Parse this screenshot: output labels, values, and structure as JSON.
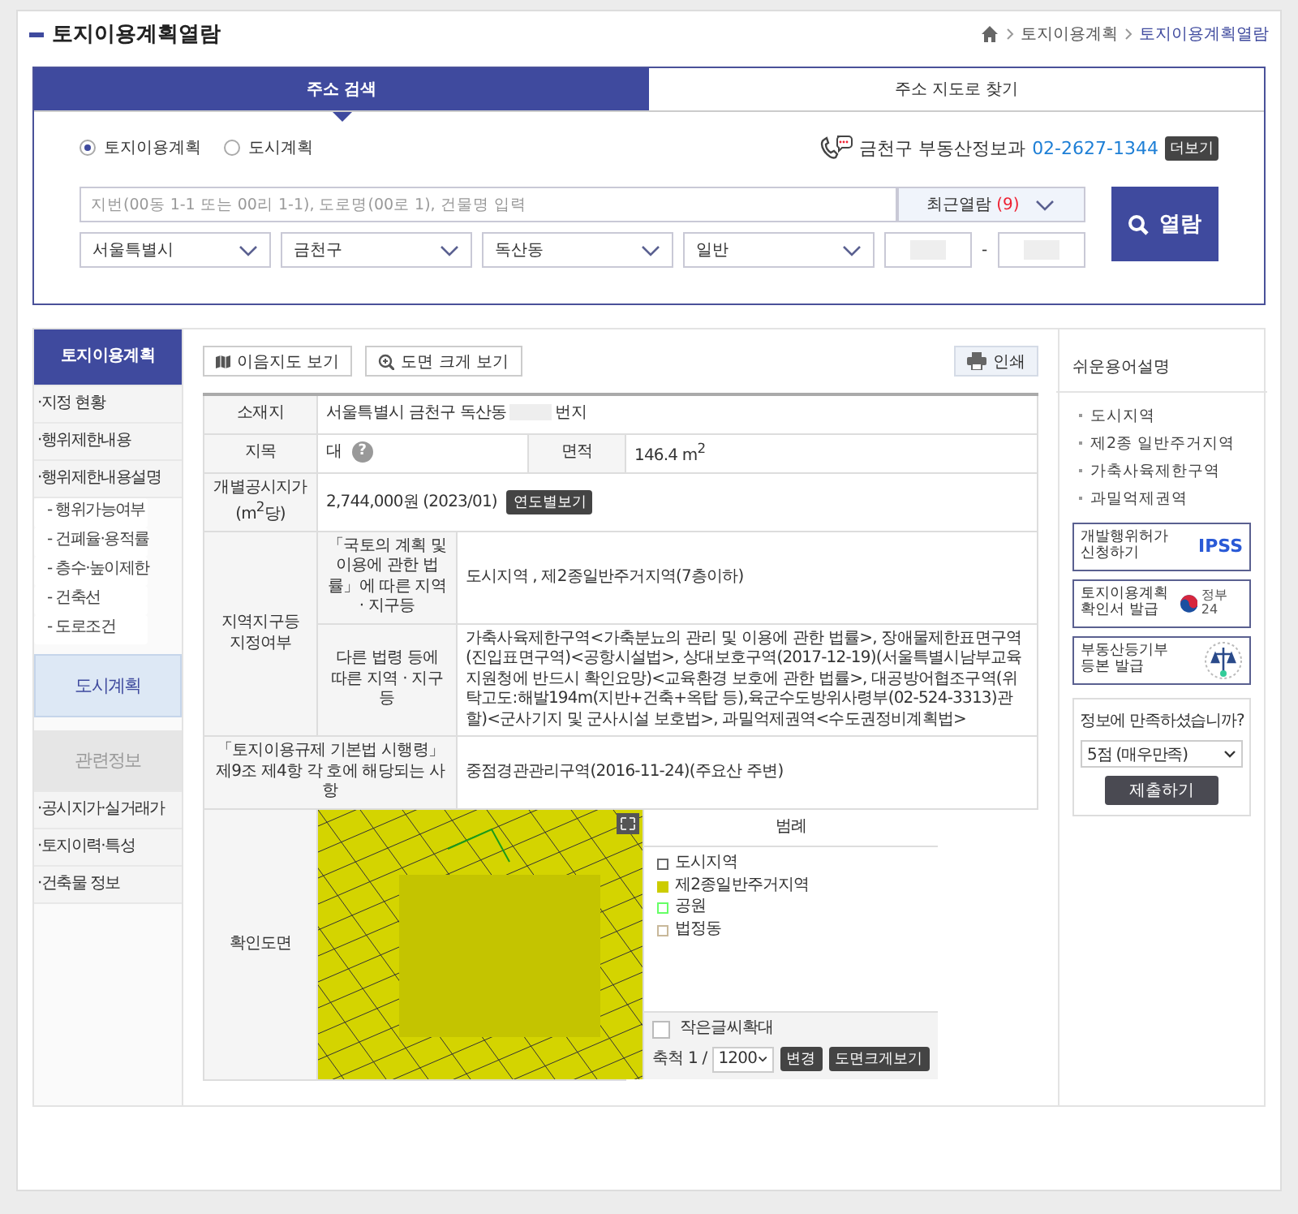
{
  "header": {
    "title": "토지이용계획열람",
    "breadcrumb": [
      {
        "label": "토지이용계획",
        "selected": false
      },
      {
        "label": "토지이용계획열람",
        "selected": true
      }
    ]
  },
  "search": {
    "tabs": [
      {
        "label": "주소 검색",
        "selected": true
      },
      {
        "label": "주소 지도로 찾기",
        "selected": false
      }
    ],
    "radios": [
      {
        "label": "토지이용계획",
        "selected": true
      },
      {
        "label": "도시계획",
        "selected": false
      }
    ],
    "contact": {
      "label": "금천구 부동산정보과",
      "phone": "02-2627-1344",
      "more": "더보기"
    },
    "input": {
      "placeholder": "지번(00동 1-1 또는 00리 1-1), 도로명(00로 1), 건물명 입력"
    },
    "recent": {
      "label": "최근열람",
      "count": "(9)"
    },
    "selects": [
      "서울특별시",
      "금천구",
      "독산동",
      "일반"
    ],
    "separator": "-",
    "button": "열람"
  },
  "sidebar": {
    "items": [
      {
        "kind": "header",
        "label": "토지이용계획"
      },
      {
        "kind": "link",
        "label": "·지정 현황"
      },
      {
        "kind": "link",
        "label": "·행위제한내용"
      },
      {
        "kind": "link",
        "label": "·행위제한내용설명"
      },
      {
        "kind": "sub",
        "label": "- 행위가능여부"
      },
      {
        "kind": "sub",
        "label": "- 건폐율·용적률"
      },
      {
        "kind": "sub",
        "label": "- 층수·높이제한"
      },
      {
        "kind": "sub",
        "label": "- 건축선"
      },
      {
        "kind": "sub",
        "label": "- 도로조건"
      },
      {
        "kind": "tile",
        "label": "도시계획"
      },
      {
        "kind": "tile-muted",
        "label": "관련정보"
      },
      {
        "kind": "link",
        "label": "·공시지가·실거래가"
      },
      {
        "kind": "link",
        "label": "·토지이력·특성"
      },
      {
        "kind": "link",
        "label": "·건축물 정보"
      }
    ]
  },
  "toolbar": {
    "buttons": [
      "이음지도 보기",
      "도면 크게 보기"
    ],
    "print": "인쇄"
  },
  "table": {
    "address": {
      "label": "소재지",
      "prefix": "서울특별시 금천구 독산동",
      "suffix": "번지"
    },
    "jimok": {
      "label": "지목",
      "value": "대",
      "help": "?",
      "area_label": "면적",
      "area": "146.4 m$^{2}$"
    },
    "price": {
      "label": "개별공시지가(m$^{2}$당)",
      "value": "2,744,000원 (2023/01)",
      "button": "연도별보기"
    },
    "zones": {
      "label": "지역지구등 지정여부",
      "rows": [
        {
          "label": "「국토의 계획 및 이용에 관한 법률」에 따른 지역 · 지구등",
          "value": "도시지역 , 제2종일반주거지역(7층이하)"
        },
        {
          "label": "다른 법령 등에 따른 지역 · 지구등",
          "value": "가축사육제한구역<가축분뇨의 관리 및 이용에 관한 법률>, 장애물제한표면구역(진입표면구역)<공항시설법>, 상대보호구역(2017-12-19)(서울특별시남부교육지원청에 반드시 확인요망)<교육환경 보호에 관한 법률>, 대공방어협조구역(위탁고도:해발194m(지반+건축+옥탑 등),육군수도방위사령부(02-524-3313)관할)<군사기지 및 군사시설 보호법>, 과밀억제권역<수도권정비계획법>"
        }
      ]
    },
    "decree": {
      "label": "「토지이용규제 기본법 시행령」 제9조 제4항 각 호에 해당되는 사항",
      "value": "중점경관관리구역(2016-11-24)(주요산 주변)"
    },
    "map": {
      "label": "확인도면",
      "legend_title": "범례",
      "legend": [
        {
          "label": "도시지역",
          "kind": "outline",
          "color": "#666666"
        },
        {
          "label": "제2종일반주거지역",
          "kind": "fill",
          "color": "#cccc00"
        },
        {
          "label": "공원",
          "kind": "outline",
          "color": "#66ff66"
        },
        {
          "label": "법정동",
          "kind": "outline",
          "color": "#c8b89a"
        }
      ],
      "enlarge": {
        "label": "작은글씨확대",
        "checked": false
      },
      "scale_label": "축척 1 /",
      "scale": "1200",
      "change": "변경",
      "big": "도면크게보기"
    }
  },
  "aside": {
    "title": "쉬운용어설명",
    "terms": [
      "도시지역",
      "제2종 일반주거지역",
      "가축사육제한구역",
      "과밀억제권역"
    ],
    "links": [
      {
        "label": "개발행위허가 신청하기",
        "kind": "ipss",
        "logo": "IPSS"
      },
      {
        "label": "토지이용계획 확인서 발급",
        "kind": "gov24",
        "logo": "정부24"
      },
      {
        "label": "부동산등기부등본 발급",
        "kind": "court"
      }
    ],
    "survey": {
      "question": "정보에 만족하셨습니까?",
      "choice": "5점 (매우만족)",
      "button": "제출하기"
    }
  }
}
